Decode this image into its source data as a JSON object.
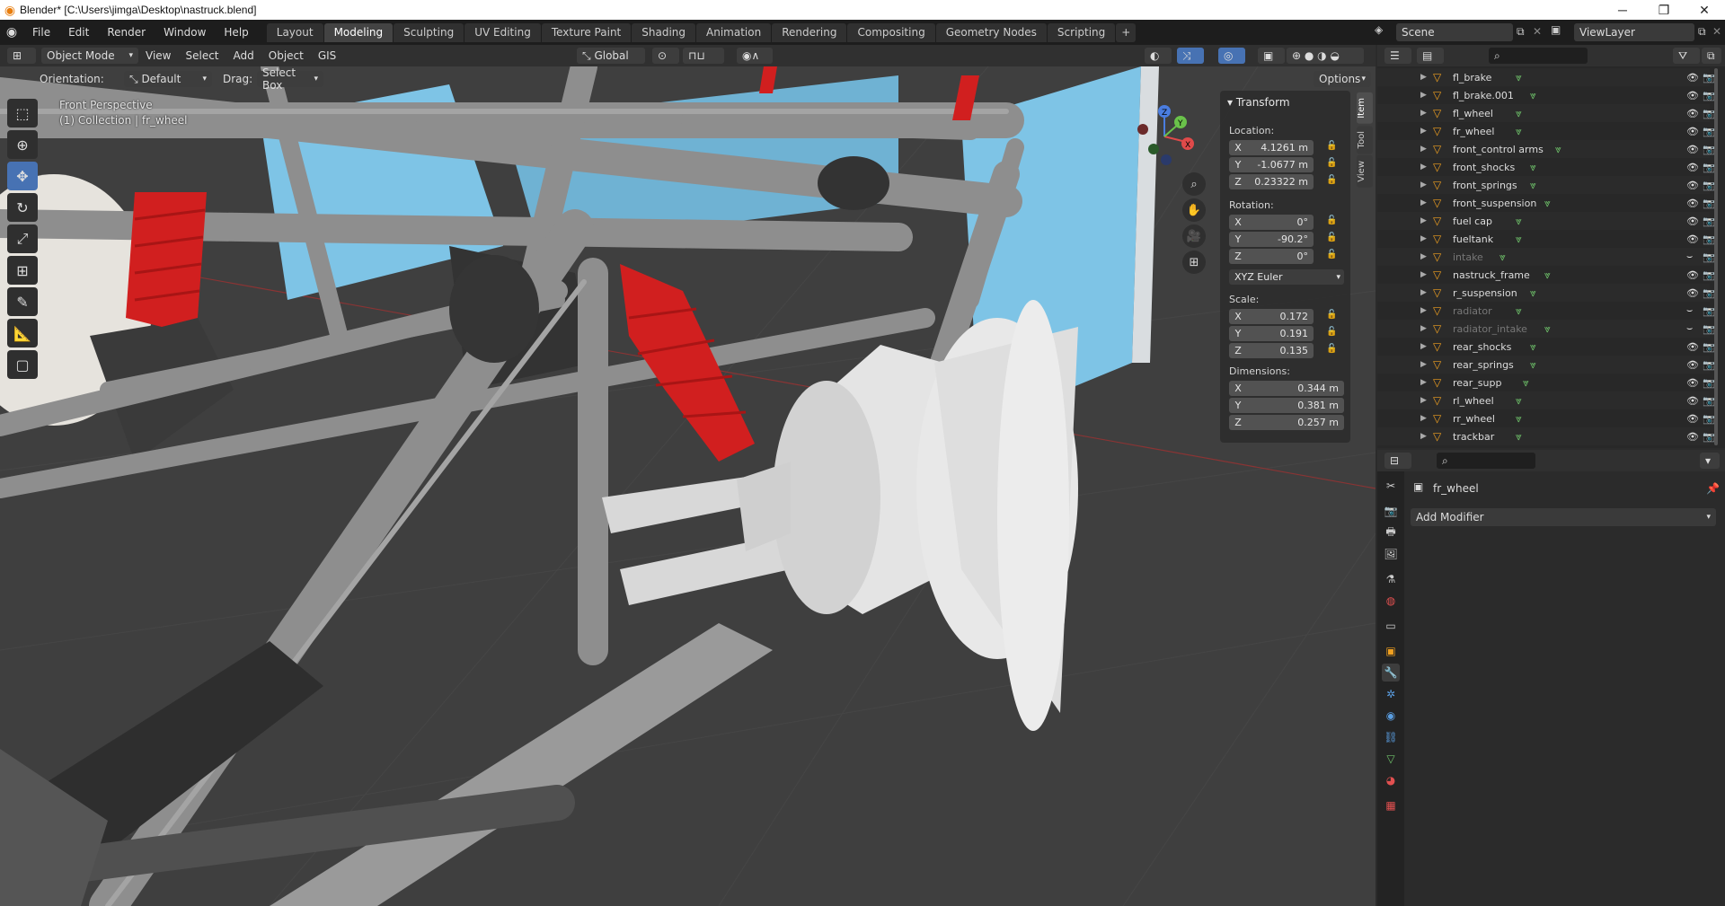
{
  "window": {
    "title": "Blender* [C:\\Users\\jimga\\Desktop\\nastruck.blend]"
  },
  "topbar": {
    "menus": [
      "File",
      "Edit",
      "Render",
      "Window",
      "Help"
    ],
    "workspaces": [
      "Layout",
      "Modeling",
      "Sculpting",
      "UV Editing",
      "Texture Paint",
      "Shading",
      "Animation",
      "Rendering",
      "Compositing",
      "Geometry Nodes",
      "Scripting"
    ],
    "active_workspace": "Modeling",
    "scene": "Scene",
    "view_layer": "ViewLayer"
  },
  "viewport_header": {
    "mode": "Object Mode",
    "menus": [
      "View",
      "Select",
      "Add",
      "Object",
      "GIS"
    ],
    "transform_orientation": "Global"
  },
  "tool_settings": {
    "orientation_label": "Orientation:",
    "orientation_value": "Default",
    "drag_label": "Drag:",
    "drag_value": "Select Box",
    "options": "Options"
  },
  "viewport": {
    "view_name": "Front Perspective",
    "collection_info": "(1) Collection | fr_wheel"
  },
  "npanel": {
    "header": "Transform",
    "location_label": "Location:",
    "location": [
      {
        "axis": "X",
        "value": "4.1261 m"
      },
      {
        "axis": "Y",
        "value": "-1.0677 m"
      },
      {
        "axis": "Z",
        "value": "0.23322 m"
      }
    ],
    "rotation_label": "Rotation:",
    "rotation": [
      {
        "axis": "X",
        "value": "0°"
      },
      {
        "axis": "Y",
        "value": "-90.2°"
      },
      {
        "axis": "Z",
        "value": "0°"
      }
    ],
    "rotation_mode": "XYZ Euler",
    "scale_label": "Scale:",
    "scale": [
      {
        "axis": "X",
        "value": "0.172"
      },
      {
        "axis": "Y",
        "value": "0.191"
      },
      {
        "axis": "Z",
        "value": "0.135"
      }
    ],
    "dimensions_label": "Dimensions:",
    "dimensions": [
      {
        "axis": "X",
        "value": "0.344 m"
      },
      {
        "axis": "Y",
        "value": "0.381 m"
      },
      {
        "axis": "Z",
        "value": "0.257 m"
      }
    ],
    "tabs": [
      "Item",
      "Tool",
      "View"
    ]
  },
  "outliner": {
    "items": [
      {
        "name": "fl_brake",
        "dim": false
      },
      {
        "name": "fl_brake.001",
        "dim": false
      },
      {
        "name": "fl_wheel",
        "dim": false
      },
      {
        "name": "fr_wheel",
        "dim": false
      },
      {
        "name": "front_control arms",
        "dim": false
      },
      {
        "name": "front_shocks",
        "dim": false
      },
      {
        "name": "front_springs",
        "dim": false
      },
      {
        "name": "front_suspension",
        "dim": false
      },
      {
        "name": "fuel cap",
        "dim": false
      },
      {
        "name": "fueltank",
        "dim": false
      },
      {
        "name": "intake",
        "dim": true
      },
      {
        "name": "nastruck_frame",
        "dim": false
      },
      {
        "name": "r_suspension",
        "dim": false
      },
      {
        "name": "radiator",
        "dim": true
      },
      {
        "name": "radiator_intake",
        "dim": true
      },
      {
        "name": "rear_shocks",
        "dim": false
      },
      {
        "name": "rear_springs",
        "dim": false
      },
      {
        "name": "rear_supp",
        "dim": false
      },
      {
        "name": "rl_wheel",
        "dim": false
      },
      {
        "name": "rr_wheel",
        "dim": false
      },
      {
        "name": "trackbar",
        "dim": false
      }
    ]
  },
  "properties": {
    "object_name": "fr_wheel",
    "add_modifier": "Add Modifier"
  },
  "colors": {
    "accent": "#4772b3",
    "spring_red": "#d11f1f",
    "panel_blue": "#7ec4e6"
  }
}
